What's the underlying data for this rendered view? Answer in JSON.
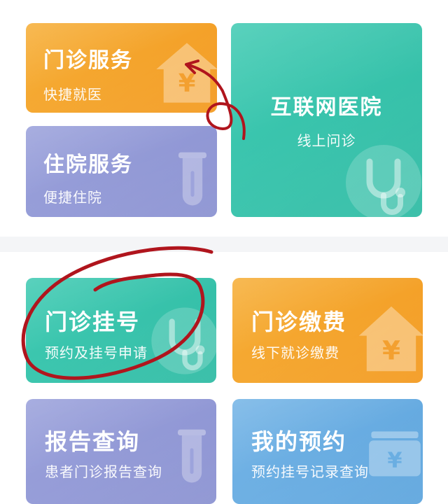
{
  "top_cards": {
    "outpatient_service": {
      "title": "门诊服务",
      "subtitle": "快捷就医",
      "icon": "house-yuan-icon"
    },
    "inpatient_service": {
      "title": "住院服务",
      "subtitle": "便捷住院",
      "icon": "test-tube-icon"
    },
    "internet_hospital": {
      "title": "互联网医院",
      "subtitle": "线上问诊",
      "icon": "stethoscope-icon"
    }
  },
  "bottom_cards": {
    "outpatient_registration": {
      "title": "门诊挂号",
      "subtitle": "预约及挂号申请",
      "icon": "stethoscope-icon"
    },
    "outpatient_payment": {
      "title": "门诊缴费",
      "subtitle": "线下就诊缴费",
      "icon": "house-yuan-icon"
    },
    "report_query": {
      "title": "报告查询",
      "subtitle": "患者门诊报告查询",
      "icon": "test-tube-icon"
    },
    "my_appointments": {
      "title": "我的预约",
      "subtitle": "预约挂号记录查询",
      "icon": "wallet-yuan-icon"
    }
  },
  "colors": {
    "orange": "#f39b22",
    "purple": "#8c93d2",
    "teal": "#31bca5",
    "blue": "#5fa6de",
    "annotation_red": "#b0151d"
  }
}
